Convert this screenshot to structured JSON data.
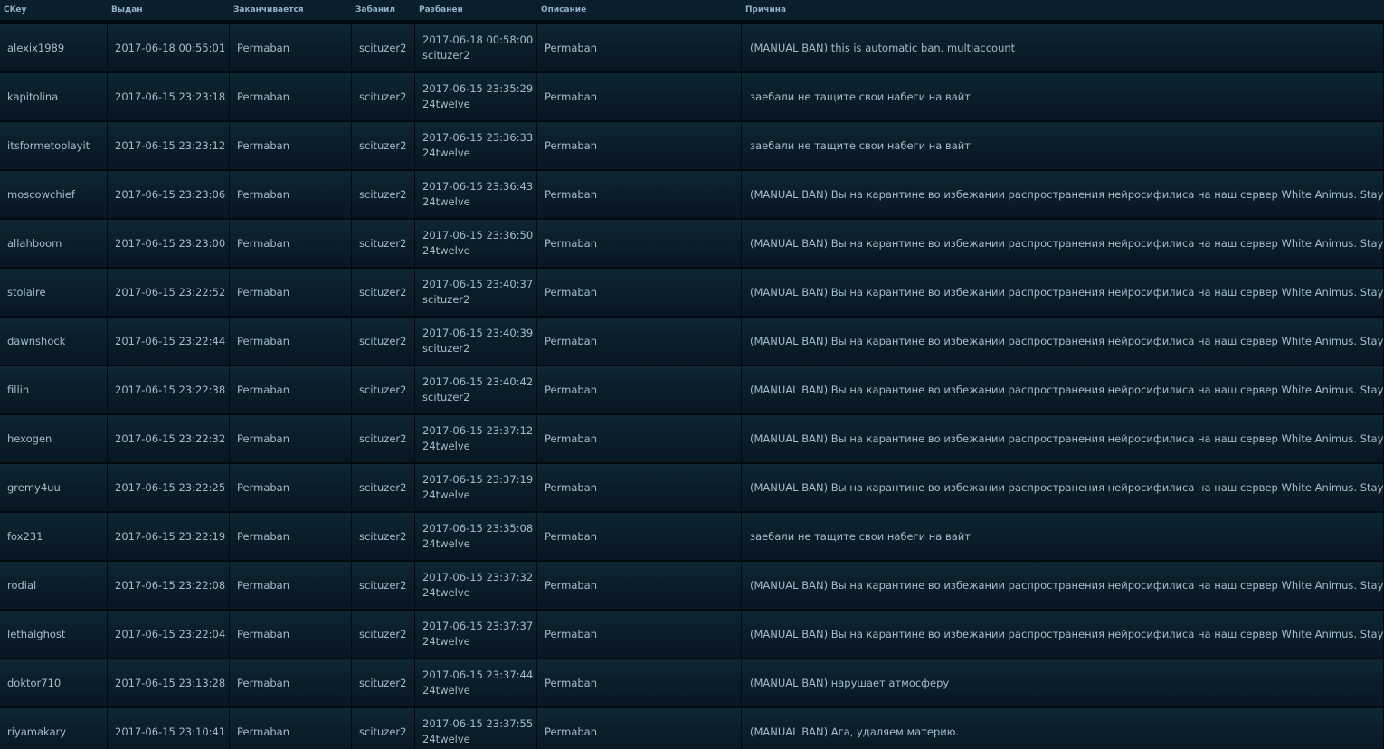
{
  "headers": {
    "ckey": "CKey",
    "issued": "Выдан",
    "expires": "Заканчивается",
    "banned_by": "Забанил",
    "unbanned": "Разбанен",
    "description": "Описание",
    "reason": "Причина"
  },
  "rows": [
    {
      "ckey": "alexix1989",
      "issued": "2017-06-18 00:55:01",
      "expires": "Permaban",
      "banned_by": "scituzer2",
      "unban_time": "2017-06-18 00:58:00",
      "unban_admin": "scituzer2",
      "description": "Permaban",
      "reason": "(MANUAL BAN) this is automatic ban. multiaccount"
    },
    {
      "ckey": "kapitolina",
      "issued": "2017-06-15 23:23:18",
      "expires": "Permaban",
      "banned_by": "scituzer2",
      "unban_time": "2017-06-15 23:35:29",
      "unban_admin": "24twelve",
      "description": "Permaban",
      "reason": "заебали не тащите свои набеги на вайт"
    },
    {
      "ckey": "itsformetoplayit",
      "issued": "2017-06-15 23:23:12",
      "expires": "Permaban",
      "banned_by": "scituzer2",
      "unban_time": "2017-06-15 23:36:33",
      "unban_admin": "24twelve",
      "description": "Permaban",
      "reason": "заебали не тащите свои набеги на вайт"
    },
    {
      "ckey": "moscowchief",
      "issued": "2017-06-15 23:23:06",
      "expires": "Permaban",
      "banned_by": "scituzer2",
      "unban_time": "2017-06-15 23:36:43",
      "unban_admin": "24twelve",
      "description": "Permaban",
      "reason": "(MANUAL BAN) Вы на карантине во избежании распространения нейросифилиса на наш сервер White Animus. Stay tuned!"
    },
    {
      "ckey": "allahboom",
      "issued": "2017-06-15 23:23:00",
      "expires": "Permaban",
      "banned_by": "scituzer2",
      "unban_time": "2017-06-15 23:36:50",
      "unban_admin": "24twelve",
      "description": "Permaban",
      "reason": "(MANUAL BAN) Вы на карантине во избежании распространения нейросифилиса на наш сервер White Animus. Stay tuned!"
    },
    {
      "ckey": "stolaire",
      "issued": "2017-06-15 23:22:52",
      "expires": "Permaban",
      "banned_by": "scituzer2",
      "unban_time": "2017-06-15 23:40:37",
      "unban_admin": "scituzer2",
      "description": "Permaban",
      "reason": "(MANUAL BAN) Вы на карантине во избежании распространения нейросифилиса на наш сервер White Animus. Stay tuned!"
    },
    {
      "ckey": "dawnshock",
      "issued": "2017-06-15 23:22:44",
      "expires": "Permaban",
      "banned_by": "scituzer2",
      "unban_time": "2017-06-15 23:40:39",
      "unban_admin": "scituzer2",
      "description": "Permaban",
      "reason": "(MANUAL BAN) Вы на карантине во избежании распространения нейросифилиса на наш сервер White Animus. Stay tuned!"
    },
    {
      "ckey": "fillin",
      "issued": "2017-06-15 23:22:38",
      "expires": "Permaban",
      "banned_by": "scituzer2",
      "unban_time": "2017-06-15 23:40:42",
      "unban_admin": "scituzer2",
      "description": "Permaban",
      "reason": "(MANUAL BAN) Вы на карантине во избежании распространения нейросифилиса на наш сервер White Animus. Stay tuned!"
    },
    {
      "ckey": "hexogen",
      "issued": "2017-06-15 23:22:32",
      "expires": "Permaban",
      "banned_by": "scituzer2",
      "unban_time": "2017-06-15 23:37:12",
      "unban_admin": "24twelve",
      "description": "Permaban",
      "reason": "(MANUAL BAN) Вы на карантине во избежании распространения нейросифилиса на наш сервер White Animus. Stay tuned!"
    },
    {
      "ckey": "gremy4uu",
      "issued": "2017-06-15 23:22:25",
      "expires": "Permaban",
      "banned_by": "scituzer2",
      "unban_time": "2017-06-15 23:37:19",
      "unban_admin": "24twelve",
      "description": "Permaban",
      "reason": "(MANUAL BAN) Вы на карантине во избежании распространения нейросифилиса на наш сервер White Animus. Stay tuned!"
    },
    {
      "ckey": "fox231",
      "issued": "2017-06-15 23:22:19",
      "expires": "Permaban",
      "banned_by": "scituzer2",
      "unban_time": "2017-06-15 23:35:08",
      "unban_admin": "24twelve",
      "description": "Permaban",
      "reason": "заебали не тащите свои набеги на вайт"
    },
    {
      "ckey": "rodial",
      "issued": "2017-06-15 23:22:08",
      "expires": "Permaban",
      "banned_by": "scituzer2",
      "unban_time": "2017-06-15 23:37:32",
      "unban_admin": "24twelve",
      "description": "Permaban",
      "reason": "(MANUAL BAN) Вы на карантине во избежании распространения нейросифилиса на наш сервер White Animus. Stay tuned!"
    },
    {
      "ckey": "lethalghost",
      "issued": "2017-06-15 23:22:04",
      "expires": "Permaban",
      "banned_by": "scituzer2",
      "unban_time": "2017-06-15 23:37:37",
      "unban_admin": "24twelve",
      "description": "Permaban",
      "reason": "(MANUAL BAN) Вы на карантине во избежании распространения нейросифилиса на наш сервер White Animus. Stay tuned!"
    },
    {
      "ckey": "doktor710",
      "issued": "2017-06-15 23:13:28",
      "expires": "Permaban",
      "banned_by": "scituzer2",
      "unban_time": "2017-06-15 23:37:44",
      "unban_admin": "24twelve",
      "description": "Permaban",
      "reason": "(MANUAL BAN) нарушает атмосферу"
    },
    {
      "ckey": "riyamakary",
      "issued": "2017-06-15 23:10:41",
      "expires": "Permaban",
      "banned_by": "scituzer2",
      "unban_time": "2017-06-15 23:37:55",
      "unban_admin": "24twelve",
      "description": "Permaban",
      "reason": "(MANUAL BAN) Ага, удаляем материю."
    }
  ]
}
